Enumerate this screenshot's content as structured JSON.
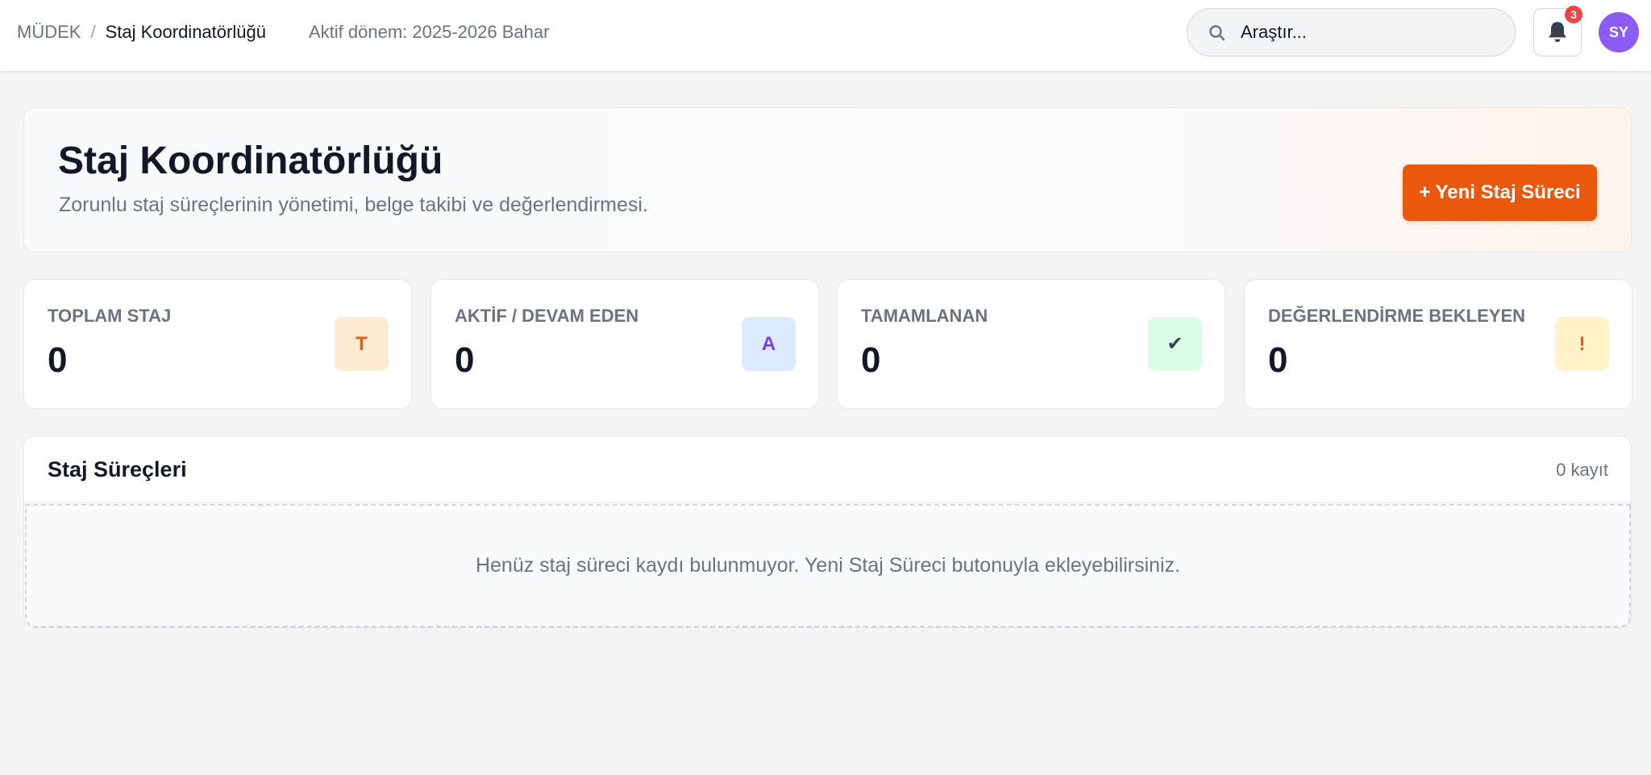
{
  "header": {
    "breadcrumb_root": "MÜDEK",
    "breadcrumb_separator": "/",
    "breadcrumb_current": "Staj Koordinatörlüğü",
    "active_term": "Aktif dönem: 2025-2026 Bahar",
    "search_placeholder": "Araştır...",
    "notification_count": "3",
    "avatar_initials": "SY",
    "search_icon": "search-icon",
    "bell_icon": "bell-icon"
  },
  "hero": {
    "title": "Staj Koordinatörlüğü",
    "subtitle": "Zorunlu staj süreçlerinin yönetimi, belge takibi ve değerlendirmesi.",
    "new_button_label": "+ Yeni Staj Süreci"
  },
  "stats": [
    {
      "label": "TOPLAM STAJ",
      "value": "0",
      "icon_text": "T",
      "icon_bg": "#fdebd3",
      "icon_color": "#ea580c"
    },
    {
      "label": "AKTİF / DEVAM EDEN",
      "value": "0",
      "icon_text": "A",
      "icon_bg": "#dbeafe",
      "icon_color": "#7c3aed"
    },
    {
      "label": "TAMAMLANAN",
      "value": "0",
      "icon_text": "✔",
      "icon_bg": "#dcfce7",
      "icon_color": "#374151"
    },
    {
      "label": "DEĞERLENDİRME BEKLEYEN",
      "value": "0",
      "icon_text": "!",
      "icon_bg": "#fef3c7",
      "icon_color": "#ea580c"
    }
  ],
  "panel": {
    "title": "Staj Süreçleri",
    "count": "0 kayıt",
    "empty_message": "Henüz staj süreci kaydı bulunmuyor. Yeni Staj Süreci butonuyla ekleyebilirsiniz."
  },
  "colors": {
    "accent": "#ea580c",
    "avatar": "#8b5cf6",
    "badge": "#ef4444"
  }
}
